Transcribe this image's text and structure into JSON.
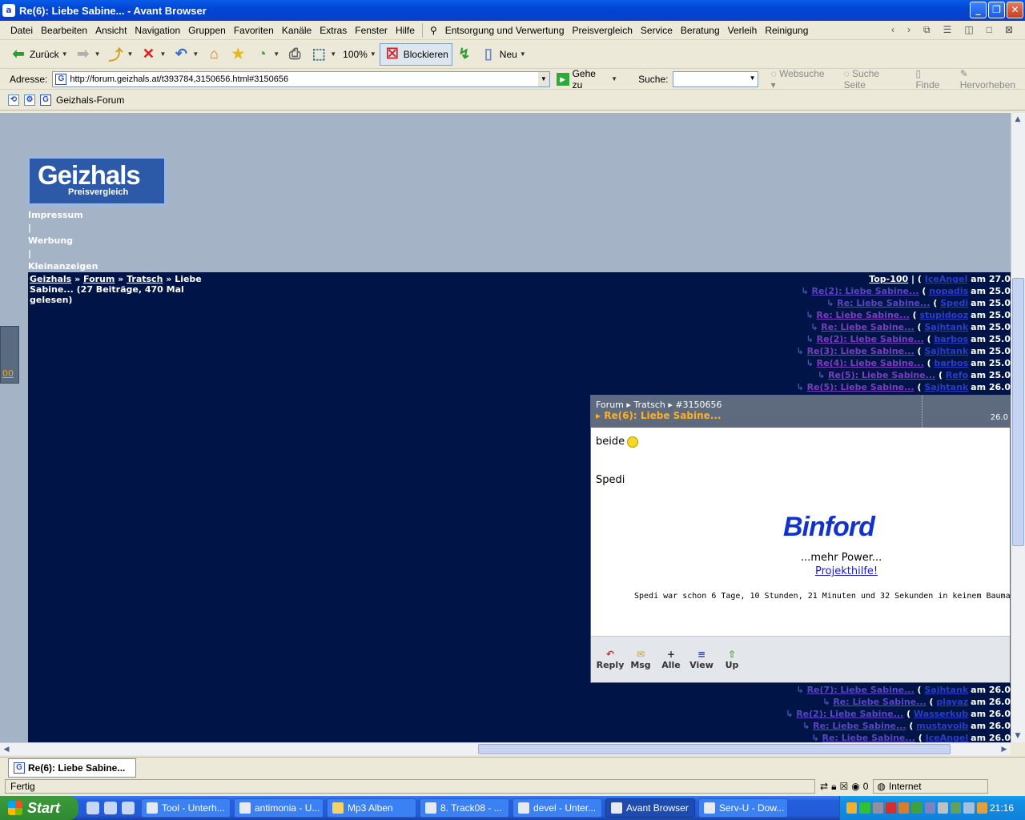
{
  "window": {
    "title": "Re(6): Liebe Sabine... - Avant Browser"
  },
  "menu": [
    "Datei",
    "Bearbeiten",
    "Ansicht",
    "Navigation",
    "Gruppen",
    "Favoriten",
    "Kanäle",
    "Extras",
    "Fenster",
    "Hilfe"
  ],
  "links_menu": [
    "Entsorgung und Verwertung",
    "Preisvergleich",
    "Service",
    "Beratung",
    "Verleih",
    "Reinigung"
  ],
  "toolbar": {
    "back": "Zurück",
    "zoom": "100%",
    "block": "Blockieren",
    "new": "Neu"
  },
  "address": {
    "label": "Adresse:",
    "url": "http://forum.geizhals.at/t393784,3150656.html#3150656",
    "go": "Gehe zu"
  },
  "search": {
    "label": "Suche:",
    "websuche": "Websuche",
    "suche_seite": "Suche Seite",
    "finde": "Finde",
    "hervorheben": "Hervorheben"
  },
  "favorites": {
    "geizhals_forum": "Geizhals-Forum"
  },
  "page": {
    "logo_main": "Geizhals",
    "logo_sub": "Preisvergleich",
    "top_links": [
      "Impressum",
      "|",
      "Werbung",
      "|",
      "Kleinanzeigen"
    ],
    "breadcrumb": {
      "site": "Geizhals",
      "sep1": " » ",
      "forum": "Forum",
      "sep2": " » ",
      "section": "Tratsch",
      "sep3": " » ",
      "rest": "Liebe Sabine... (27 Beiträge, 470 Mal gelesen)"
    },
    "top100": {
      "label": "Top-100",
      "rest": " | ( ",
      "author": "IceAngel",
      "date": "am 27.0"
    },
    "left_stub": "00",
    "thread_top": [
      {
        "title": "Re(2): Liebe Sabine...",
        "author": "nopadis",
        "date": "am 25.0"
      },
      {
        "title": "Re: Liebe Sabine...",
        "author": "Spedi",
        "date": "am 25.0"
      },
      {
        "title": "Re: Liebe Sabine...",
        "author": "stupidooz",
        "date": "am 25.0"
      },
      {
        "title": "Re: Liebe Sabine...",
        "author": "Sajhtank",
        "date": "am 25.0"
      },
      {
        "title": "Re(2): Liebe Sabine...",
        "author": "barbos",
        "date": "am 25.0"
      },
      {
        "title": "Re(3): Liebe Sabine...",
        "author": "Sajhtank",
        "date": "am 25.0"
      },
      {
        "title": "Re(4): Liebe Sabine...",
        "author": "barbos",
        "date": "am 25.0"
      },
      {
        "title": "Re(5): Liebe Sabine...",
        "author": "Refo",
        "date": "am 25.0"
      },
      {
        "title": "Re(5): Liebe Sabine...",
        "author": "Sajhtank",
        "date": "am 26.0"
      }
    ],
    "thread_bottom": [
      {
        "title": "Re(7): Liebe Sabine...",
        "author": "Sajhtank",
        "date": "am 26.0"
      },
      {
        "title": "Re: Liebe Sabine...",
        "author": "playaz",
        "date": "am 26.0"
      },
      {
        "title": "Re(2): Liebe Sabine...",
        "author": "Wasserkub",
        "date": "am 26.0"
      },
      {
        "title": "Re: Liebe Sabine...",
        "author": "mustavoib",
        "date": "am 26.0"
      },
      {
        "title": "Re: Liebe Sabine...",
        "author": "IceAngel",
        "date": "am 26.0"
      }
    ],
    "popup": {
      "crumb": [
        "Forum",
        "Tratsch",
        "#3150656"
      ],
      "title": "Re(6): Liebe Sabine...",
      "date": "26.0",
      "body": "beide",
      "signature": "Spedi",
      "binford": "Binford",
      "mehr_power": "...mehr Power...",
      "projekthilfe": "Projekthilfe!",
      "spedi_line": "Spedi war schon 6 Tage, 10 Stunden, 21 Minuten und 32 Sekunden in keinem Baumar",
      "buttons": [
        "Reply",
        "Msg",
        "Alle",
        "View",
        "Up"
      ]
    }
  },
  "tab": {
    "label": "Re(6): Liebe Sabine..."
  },
  "status": {
    "text": "Fertig",
    "zone": "Internet",
    "count": "0"
  },
  "taskbar": {
    "start": "Start",
    "tasks": [
      "Tool - Unterh...",
      "antimonia - U...",
      "Mp3 Alben",
      "8. Track08 - ...",
      "devel - Unter...",
      "Avant Browser",
      "Serv-U - Dow..."
    ],
    "clock": "21:16"
  }
}
